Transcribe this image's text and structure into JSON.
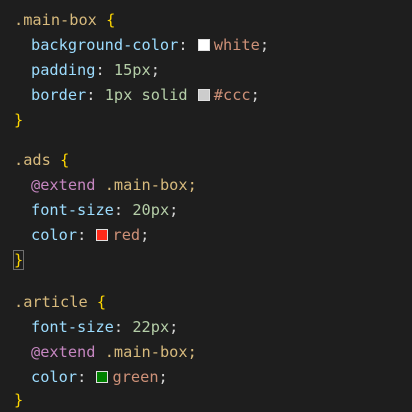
{
  "rules": [
    {
      "selector": ".main-box",
      "lines": [
        {
          "prop": "background-color",
          "swatch": "#ffffff",
          "value": "white"
        },
        {
          "prop": "padding",
          "value": "15px"
        },
        {
          "prop": "border",
          "value": "1px solid",
          "swatch": "#cccccc",
          "value2": "#ccc"
        }
      ]
    },
    {
      "selector": ".ads",
      "lines": [
        {
          "directive": "@extend",
          "target": ".main-box;"
        },
        {
          "prop": "font-size",
          "value": "20px"
        },
        {
          "prop": "color",
          "swatch": "#ff2a1a",
          "value": "red"
        }
      ]
    },
    {
      "selector": ".article",
      "lines": [
        {
          "prop": "font-size",
          "value": "22px"
        },
        {
          "directive": "@extend",
          "target": ".main-box;"
        },
        {
          "prop": "color",
          "swatch": "#008000",
          "value": "green"
        }
      ]
    }
  ],
  "colors": {
    "background": "#1e1e1e",
    "selector": "#d7ba7d",
    "property": "#9cdcfe",
    "number": "#b5cea8",
    "keyword": "#c586c0",
    "string": "#ce9178",
    "bracket": "#ffd700"
  }
}
